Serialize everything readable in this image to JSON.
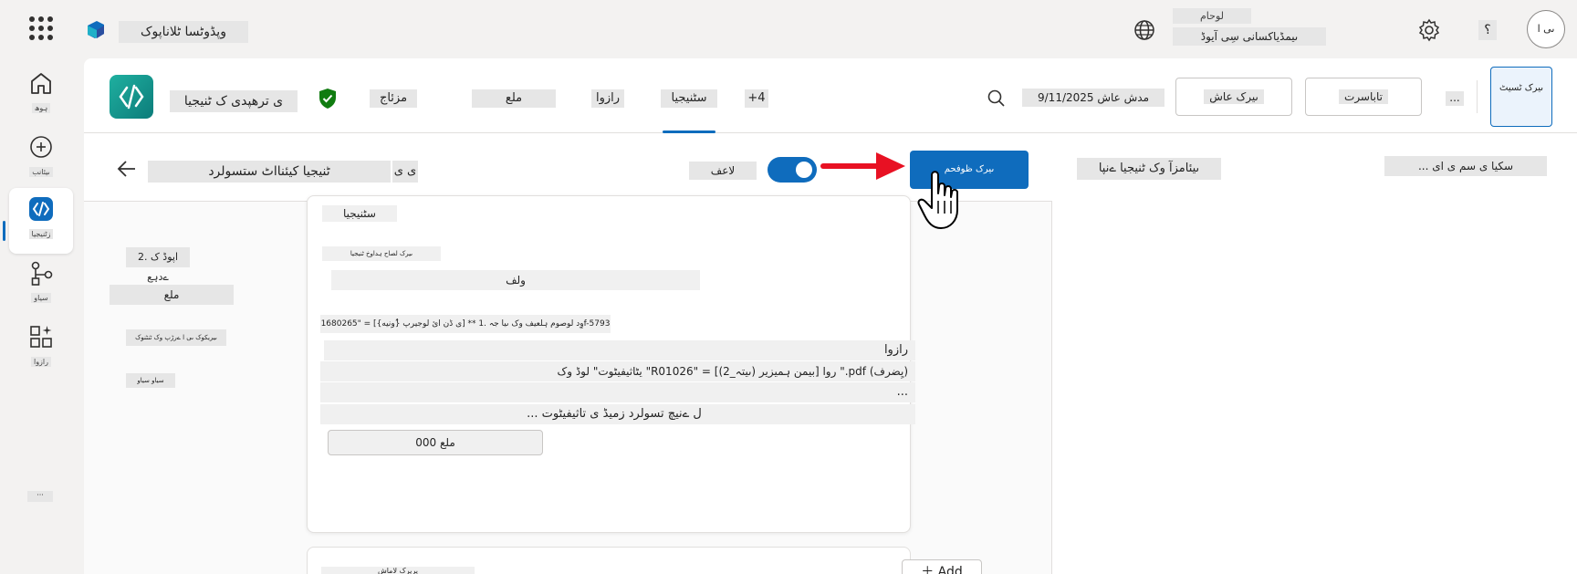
{
  "topbar": {
    "app_name": "وپڈوٹسا ٹلاناپوک",
    "environment_label": "لوحام",
    "environment_value": "ںیمڈیاکسانی سِی آیوڈ",
    "help": "؟",
    "avatar": "ںی ا"
  },
  "rail": {
    "items": [
      {
        "label": "ہوھ",
        "icon": "home-icon"
      },
      {
        "label": "ںیئانب",
        "icon": "create-icon"
      },
      {
        "label": "زٹنیجیا",
        "icon": "agents-icon"
      },
      {
        "label": "سیاو",
        "icon": "flows-icon"
      },
      {
        "label": "رازوا",
        "icon": "tools-icon"
      }
    ],
    "more": "···"
  },
  "agent": {
    "name": "ی ترهپدی ک ٹنیجیا",
    "tabs": [
      "مزئاج",
      "ملع",
      "رازوا",
      "سٹنیجیا",
      "+4"
    ],
    "search_label": "وا",
    "date": "9/11/2025 مدش عاش",
    "publish": "ںیرک عاش",
    "settings": "تاباسرت",
    "more": "...",
    "test": "ںیرک ٹسیٹ"
  },
  "editor": {
    "title": "ٹنیجیا کیئنااٹ ستسولرد",
    "subtitle": "ی ی",
    "toggle_label": "لاعف",
    "save": "ںیرک ظوفحم",
    "side_items": [
      "2. اپوڈ ک ےدہع",
      "ملع",
      "ںیریکوک ںی ا ےرڑپ وک ٹنٹنوک",
      "سیاو سیاو"
    ],
    "card": {
      "heading": "سٹنیجیا",
      "description": "ںیرک لصاح ہداوخ ٹنیجیا",
      "knowledge": "ولف",
      "instruction": "وِد لوصوم ہلعیف وک ںیا جہ .1 ** [ی ڈن ائ لوجیرپ {ُونیه}] = \"1680265f-5793",
      "rows": [
        "رازوا",
        "یٹاثیفیٹوت\" لوڈ وک \"R01026\" = [(2_ںیتہ) بیمن ہمیزیر] روا \".pdf (یِضرف)",
        "...",
        "... ل ےنیچ تسولرد زمیڈ ی تاثیفیٹوت"
      ],
      "files_button": "000 ملع"
    },
    "card2_label": "یریرک لاماش",
    "add_button": "Add"
  },
  "right_panel": {
    "title": "ںیئامزآ وک ٹنیجیا ےنپا",
    "action": "... سکیا ی سم ی ای"
  },
  "colors": {
    "accent": "#0f6cbd",
    "arrow": "#e81123",
    "agent_icon": "#1fb0a0"
  }
}
